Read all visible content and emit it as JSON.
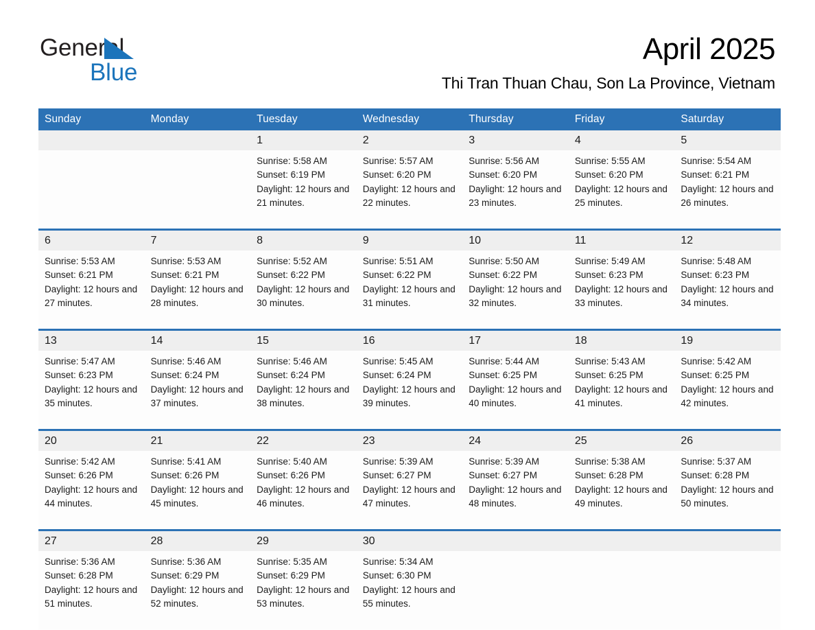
{
  "brand": {
    "logo_text_1": "General",
    "logo_text_2": "Blue",
    "logo_icon": "triangle-icon",
    "accent_color": "#1b74bb"
  },
  "header": {
    "month_title": "April 2025",
    "location": "Thi Tran Thuan Chau, Son La Province, Vietnam",
    "header_bg_color": "#2c72b5",
    "date_band_color": "#efefef"
  },
  "calendar": {
    "weekday_headers": [
      "Sunday",
      "Monday",
      "Tuesday",
      "Wednesday",
      "Thursday",
      "Friday",
      "Saturday"
    ],
    "weeks": [
      [
        {
          "day": "",
          "sunrise": "",
          "sunset": "",
          "daylight": ""
        },
        {
          "day": "",
          "sunrise": "",
          "sunset": "",
          "daylight": ""
        },
        {
          "day": "1",
          "sunrise": "Sunrise: 5:58 AM",
          "sunset": "Sunset: 6:19 PM",
          "daylight": "Daylight: 12 hours and 21 minutes."
        },
        {
          "day": "2",
          "sunrise": "Sunrise: 5:57 AM",
          "sunset": "Sunset: 6:20 PM",
          "daylight": "Daylight: 12 hours and 22 minutes."
        },
        {
          "day": "3",
          "sunrise": "Sunrise: 5:56 AM",
          "sunset": "Sunset: 6:20 PM",
          "daylight": "Daylight: 12 hours and 23 minutes."
        },
        {
          "day": "4",
          "sunrise": "Sunrise: 5:55 AM",
          "sunset": "Sunset: 6:20 PM",
          "daylight": "Daylight: 12 hours and 25 minutes."
        },
        {
          "day": "5",
          "sunrise": "Sunrise: 5:54 AM",
          "sunset": "Sunset: 6:21 PM",
          "daylight": "Daylight: 12 hours and 26 minutes."
        }
      ],
      [
        {
          "day": "6",
          "sunrise": "Sunrise: 5:53 AM",
          "sunset": "Sunset: 6:21 PM",
          "daylight": "Daylight: 12 hours and 27 minutes."
        },
        {
          "day": "7",
          "sunrise": "Sunrise: 5:53 AM",
          "sunset": "Sunset: 6:21 PM",
          "daylight": "Daylight: 12 hours and 28 minutes."
        },
        {
          "day": "8",
          "sunrise": "Sunrise: 5:52 AM",
          "sunset": "Sunset: 6:22 PM",
          "daylight": "Daylight: 12 hours and 30 minutes."
        },
        {
          "day": "9",
          "sunrise": "Sunrise: 5:51 AM",
          "sunset": "Sunset: 6:22 PM",
          "daylight": "Daylight: 12 hours and 31 minutes."
        },
        {
          "day": "10",
          "sunrise": "Sunrise: 5:50 AM",
          "sunset": "Sunset: 6:22 PM",
          "daylight": "Daylight: 12 hours and 32 minutes."
        },
        {
          "day": "11",
          "sunrise": "Sunrise: 5:49 AM",
          "sunset": "Sunset: 6:23 PM",
          "daylight": "Daylight: 12 hours and 33 minutes."
        },
        {
          "day": "12",
          "sunrise": "Sunrise: 5:48 AM",
          "sunset": "Sunset: 6:23 PM",
          "daylight": "Daylight: 12 hours and 34 minutes."
        }
      ],
      [
        {
          "day": "13",
          "sunrise": "Sunrise: 5:47 AM",
          "sunset": "Sunset: 6:23 PM",
          "daylight": "Daylight: 12 hours and 35 minutes."
        },
        {
          "day": "14",
          "sunrise": "Sunrise: 5:46 AM",
          "sunset": "Sunset: 6:24 PM",
          "daylight": "Daylight: 12 hours and 37 minutes."
        },
        {
          "day": "15",
          "sunrise": "Sunrise: 5:46 AM",
          "sunset": "Sunset: 6:24 PM",
          "daylight": "Daylight: 12 hours and 38 minutes."
        },
        {
          "day": "16",
          "sunrise": "Sunrise: 5:45 AM",
          "sunset": "Sunset: 6:24 PM",
          "daylight": "Daylight: 12 hours and 39 minutes."
        },
        {
          "day": "17",
          "sunrise": "Sunrise: 5:44 AM",
          "sunset": "Sunset: 6:25 PM",
          "daylight": "Daylight: 12 hours and 40 minutes."
        },
        {
          "day": "18",
          "sunrise": "Sunrise: 5:43 AM",
          "sunset": "Sunset: 6:25 PM",
          "daylight": "Daylight: 12 hours and 41 minutes."
        },
        {
          "day": "19",
          "sunrise": "Sunrise: 5:42 AM",
          "sunset": "Sunset: 6:25 PM",
          "daylight": "Daylight: 12 hours and 42 minutes."
        }
      ],
      [
        {
          "day": "20",
          "sunrise": "Sunrise: 5:42 AM",
          "sunset": "Sunset: 6:26 PM",
          "daylight": "Daylight: 12 hours and 44 minutes."
        },
        {
          "day": "21",
          "sunrise": "Sunrise: 5:41 AM",
          "sunset": "Sunset: 6:26 PM",
          "daylight": "Daylight: 12 hours and 45 minutes."
        },
        {
          "day": "22",
          "sunrise": "Sunrise: 5:40 AM",
          "sunset": "Sunset: 6:26 PM",
          "daylight": "Daylight: 12 hours and 46 minutes."
        },
        {
          "day": "23",
          "sunrise": "Sunrise: 5:39 AM",
          "sunset": "Sunset: 6:27 PM",
          "daylight": "Daylight: 12 hours and 47 minutes."
        },
        {
          "day": "24",
          "sunrise": "Sunrise: 5:39 AM",
          "sunset": "Sunset: 6:27 PM",
          "daylight": "Daylight: 12 hours and 48 minutes."
        },
        {
          "day": "25",
          "sunrise": "Sunrise: 5:38 AM",
          "sunset": "Sunset: 6:28 PM",
          "daylight": "Daylight: 12 hours and 49 minutes."
        },
        {
          "day": "26",
          "sunrise": "Sunrise: 5:37 AM",
          "sunset": "Sunset: 6:28 PM",
          "daylight": "Daylight: 12 hours and 50 minutes."
        }
      ],
      [
        {
          "day": "27",
          "sunrise": "Sunrise: 5:36 AM",
          "sunset": "Sunset: 6:28 PM",
          "daylight": "Daylight: 12 hours and 51 minutes."
        },
        {
          "day": "28",
          "sunrise": "Sunrise: 5:36 AM",
          "sunset": "Sunset: 6:29 PM",
          "daylight": "Daylight: 12 hours and 52 minutes."
        },
        {
          "day": "29",
          "sunrise": "Sunrise: 5:35 AM",
          "sunset": "Sunset: 6:29 PM",
          "daylight": "Daylight: 12 hours and 53 minutes."
        },
        {
          "day": "30",
          "sunrise": "Sunrise: 5:34 AM",
          "sunset": "Sunset: 6:30 PM",
          "daylight": "Daylight: 12 hours and 55 minutes."
        },
        {
          "day": "",
          "sunrise": "",
          "sunset": "",
          "daylight": ""
        },
        {
          "day": "",
          "sunrise": "",
          "sunset": "",
          "daylight": ""
        },
        {
          "day": "",
          "sunrise": "",
          "sunset": "",
          "daylight": ""
        }
      ]
    ]
  }
}
